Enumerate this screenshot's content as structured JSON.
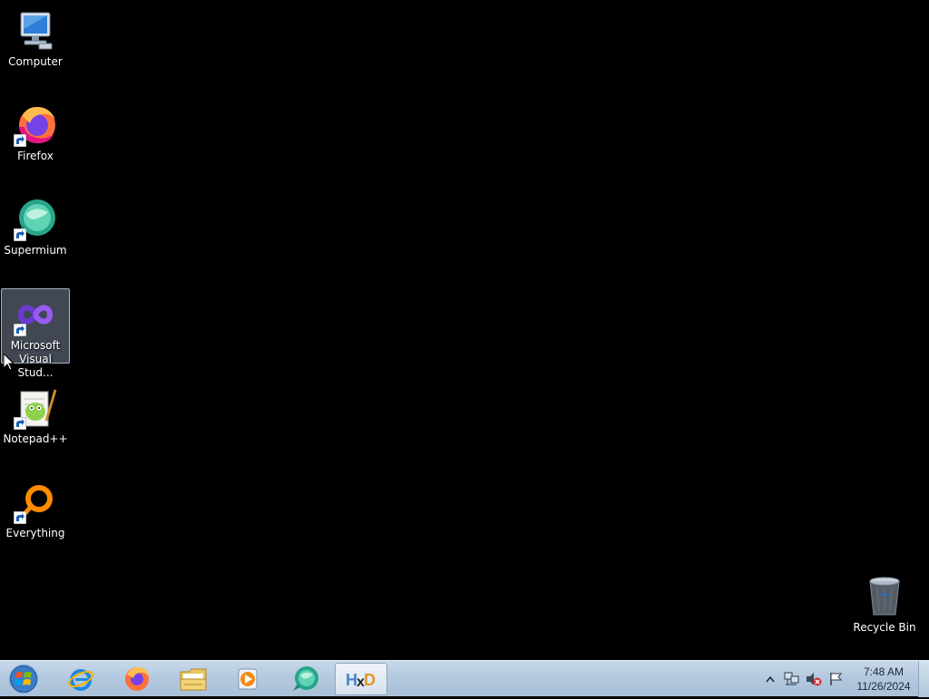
{
  "desktop": {
    "icons": [
      {
        "label": "Computer",
        "icon": "computer-icon",
        "shortcut": false
      },
      {
        "label": "Firefox",
        "icon": "firefox-icon",
        "shortcut": true
      },
      {
        "label": "Supermium",
        "icon": "supermium-icon",
        "shortcut": true
      },
      {
        "label": "Microsoft Visual Stud...",
        "icon": "visual-studio-icon",
        "shortcut": true,
        "selected": true
      },
      {
        "label": "Notepad++",
        "icon": "notepad-plus-plus-icon",
        "shortcut": true
      },
      {
        "label": "Everything",
        "icon": "everything-icon",
        "shortcut": true
      }
    ],
    "recycle_bin": {
      "label": "Recycle Bin",
      "icon": "recycle-bin-icon"
    }
  },
  "taskbar": {
    "start": {
      "icon": "windows-logo-icon"
    },
    "pinned": [
      {
        "name": "Internet Explorer",
        "icon": "internet-explorer-icon"
      },
      {
        "name": "Firefox",
        "icon": "firefox-icon"
      },
      {
        "name": "Windows Explorer",
        "icon": "folder-icon"
      },
      {
        "name": "Windows Media Player",
        "icon": "media-player-icon"
      },
      {
        "name": "Supermium",
        "icon": "supermium-icon"
      },
      {
        "name": "HxD",
        "icon": "hxd-icon",
        "active": true
      }
    ],
    "tray": {
      "icons": [
        "show-hidden-icons-chevron",
        "network-icon",
        "volume-muted-icon",
        "action-center-flag-icon"
      ],
      "time": "7:48 AM",
      "date": "11/26/2024"
    }
  },
  "colors": {
    "desktop_background": "#000000",
    "taskbar_top": "#c8d9ea",
    "taskbar_bottom": "#a9c0d8",
    "label_text": "#ffffff"
  }
}
